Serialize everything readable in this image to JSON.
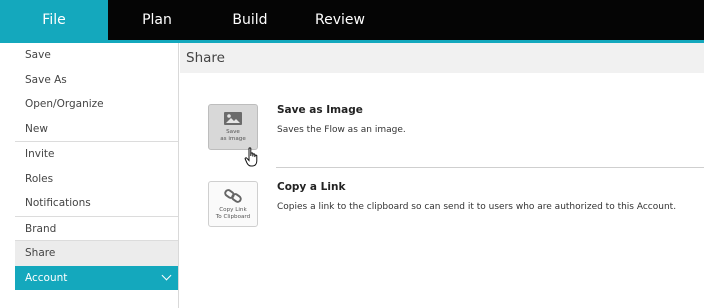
{
  "nav": {
    "tabs": [
      {
        "label": "File"
      },
      {
        "label": "Plan"
      },
      {
        "label": "Build"
      },
      {
        "label": "Review"
      }
    ]
  },
  "sidebar": {
    "groups": [
      [
        "Save",
        "Save As",
        "Open/Organize",
        "New"
      ],
      [
        "Invite",
        "Roles",
        "Notifications"
      ],
      [
        "Brand",
        "Share"
      ]
    ],
    "account_label": "Account"
  },
  "main": {
    "header": "Share",
    "options": [
      {
        "title": "Save as Image",
        "description": "Saves the Flow as an image.",
        "button_caption_1": "Save",
        "button_caption_2": "as image",
        "icon": "image-icon"
      },
      {
        "title": "Copy a Link",
        "description": "Copies a link to the clipboard so can send it to users who are authorized to this Account.",
        "button_caption_1": "Copy Link",
        "button_caption_2": "To Clipboard",
        "icon": "link-icon"
      }
    ]
  },
  "colors": {
    "accent": "#14a8bd",
    "topbar": "#050505"
  }
}
